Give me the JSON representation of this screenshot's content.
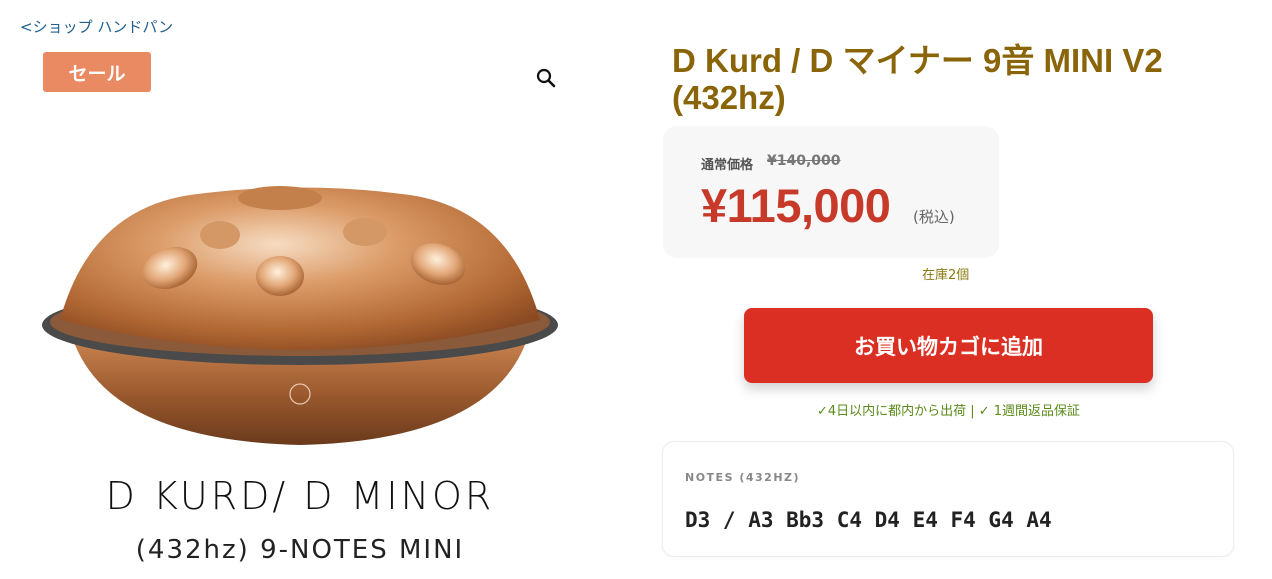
{
  "breadcrumb": {
    "label": "<ショップ ハンドパン"
  },
  "badge": {
    "sale": "セール"
  },
  "gallery": {
    "zoom_icon": "magnifier-icon",
    "image_caption_line1": "D KURD/ D MINOR",
    "image_caption_line2": "(432hz) 9-NOTES MINI"
  },
  "product": {
    "title": "D Kurd / D マイナー 9音 MINI V2 (432hz)"
  },
  "price": {
    "regular_label": "通常価格",
    "regular_price": "¥140,000",
    "sale_price": "¥115,000",
    "tax_note": "(税込)"
  },
  "stock": {
    "label": "在庫2個"
  },
  "cart": {
    "button_label": "お買い物カゴに追加"
  },
  "shipping": {
    "note": "✓4日以内に都内から出荷 | ✓ 1週間返品保証"
  },
  "notes": {
    "label": "NOTES (432HZ)",
    "value": "D3 / A3 Bb3 C4 D4 E4 F4 G4 A4"
  },
  "colors": {
    "title": "#8a6408",
    "sale_badge": "#e98a63",
    "sale_price": "#c73a2a",
    "cart_button": "#dc2f23",
    "stock": "#8a7a10",
    "shipping": "#5a8a1a"
  }
}
